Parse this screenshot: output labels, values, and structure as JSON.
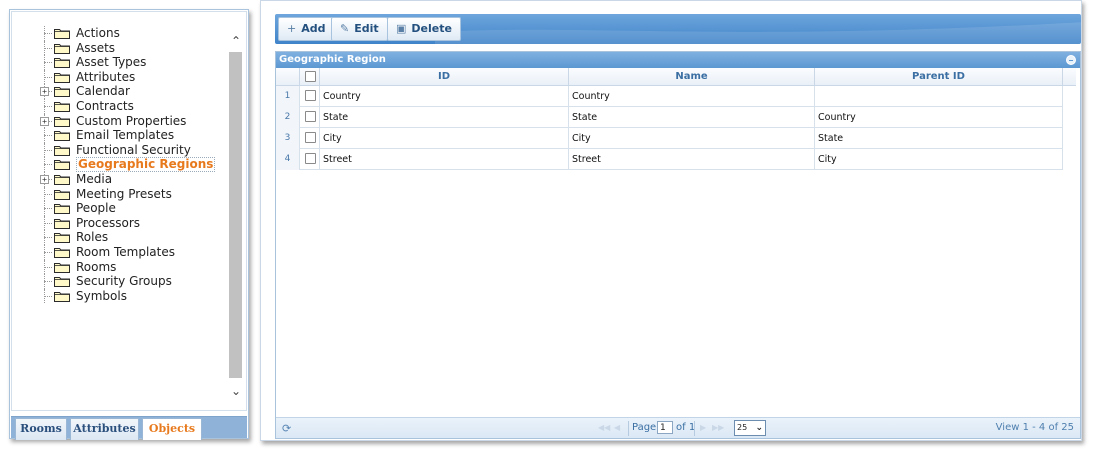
{
  "tree": {
    "items": [
      {
        "label": "Actions",
        "expandable": false
      },
      {
        "label": "Assets",
        "expandable": false
      },
      {
        "label": "Asset Types",
        "expandable": false
      },
      {
        "label": "Attributes",
        "expandable": false
      },
      {
        "label": "Calendar",
        "expandable": true
      },
      {
        "label": "Contracts",
        "expandable": false
      },
      {
        "label": "Custom Properties",
        "expandable": true
      },
      {
        "label": "Email Templates",
        "expandable": false
      },
      {
        "label": "Functional Security",
        "expandable": false
      },
      {
        "label": "Geographic Regions",
        "expandable": false,
        "selected": true
      },
      {
        "label": "Media",
        "expandable": true
      },
      {
        "label": "Meeting Presets",
        "expandable": false
      },
      {
        "label": "People",
        "expandable": false
      },
      {
        "label": "Processors",
        "expandable": false
      },
      {
        "label": "Roles",
        "expandable": false
      },
      {
        "label": "Room Templates",
        "expandable": false
      },
      {
        "label": "Rooms",
        "expandable": false
      },
      {
        "label": "Security Groups",
        "expandable": false
      },
      {
        "label": "Symbols",
        "expandable": false
      }
    ]
  },
  "left_tabs": [
    {
      "label": "Rooms",
      "active": false
    },
    {
      "label": "Attributes",
      "active": false
    },
    {
      "label": "Objects",
      "active": true
    }
  ],
  "toolbar": {
    "add_label": "Add",
    "edit_label": "Edit",
    "delete_label": "Delete"
  },
  "grid": {
    "title": "Geographic Region",
    "columns": [
      "ID",
      "Name",
      "Parent ID"
    ],
    "rows": [
      {
        "num": "1",
        "id": "Country",
        "name": "Country",
        "parent": ""
      },
      {
        "num": "2",
        "id": "State",
        "name": "State",
        "parent": "Country"
      },
      {
        "num": "3",
        "id": "City",
        "name": "City",
        "parent": "State"
      },
      {
        "num": "4",
        "id": "Street",
        "name": "Street",
        "parent": "City"
      }
    ]
  },
  "pager": {
    "page_label": "Page",
    "page_value": "1",
    "of_label": "of 1",
    "page_size": "25",
    "view_info": "View 1 - 4 of 25"
  },
  "colors": {
    "accent": "#e87a1e",
    "toolbar": "#4a8bcc",
    "header_text": "#3b6fa3"
  }
}
